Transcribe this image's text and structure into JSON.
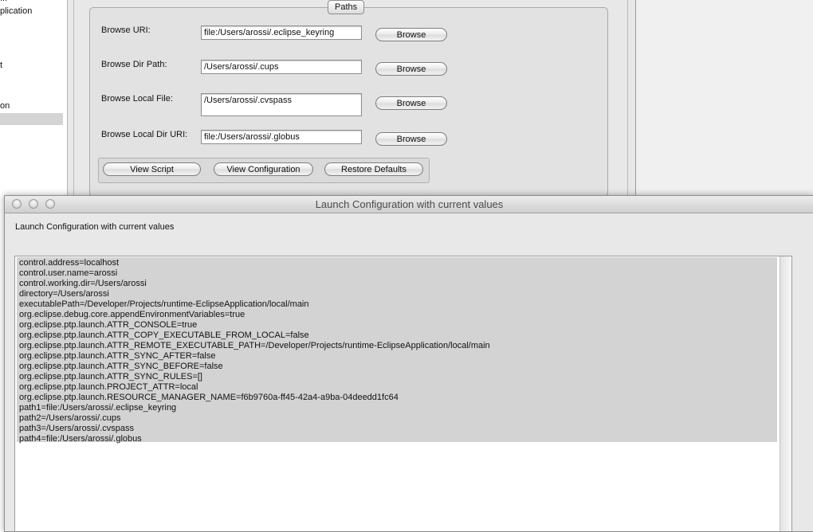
{
  "background": {
    "left_list": [
      "...",
      "plication",
      "t",
      "on"
    ],
    "group_title": "Paths",
    "fields": [
      {
        "label": "Browse URI:",
        "value": "file:/Users/arossi/.eclipse_keyring",
        "button": "Browse"
      },
      {
        "label": "Browse Dir Path:",
        "value": "/Users/arossi/.cups",
        "button": "Browse"
      },
      {
        "label": "Browse Local File:",
        "value": " /Users/arossi/.cvspass",
        "button": "Browse"
      },
      {
        "label": "Browse Local Dir URI:",
        "value": "file:/Users/arossi/.globus",
        "button": "Browse"
      }
    ],
    "actions": {
      "view_script": "View Script",
      "view_configuration": "View Configuration",
      "restore_defaults": "Restore Defaults"
    }
  },
  "window": {
    "title": "Launch Configuration with current values",
    "subtitle": "Launch Configuration with current values",
    "lines": [
      "control.address=localhost",
      "control.user.name=arossi",
      "control.working.dir=/Users/arossi",
      "directory=/Users/arossi",
      "executablePath=/Developer/Projects/runtime-EclipseApplication/local/main",
      "org.eclipse.debug.core.appendEnvironmentVariables=true",
      "org.eclipse.ptp.launch.ATTR_CONSOLE=true",
      "org.eclipse.ptp.launch.ATTR_COPY_EXECUTABLE_FROM_LOCAL=false",
      "org.eclipse.ptp.launch.ATTR_REMOTE_EXECUTABLE_PATH=/Developer/Projects/runtime-EclipseApplication/local/main",
      "org.eclipse.ptp.launch.ATTR_SYNC_AFTER=false",
      "org.eclipse.ptp.launch.ATTR_SYNC_BEFORE=false",
      "org.eclipse.ptp.launch.ATTR_SYNC_RULES=[]",
      "org.eclipse.ptp.launch.PROJECT_ATTR=local",
      "org.eclipse.ptp.launch.RESOURCE_MANAGER_NAME=f6b9760a-ff45-42a4-a9ba-04deedd1fc64",
      "path1=file:/Users/arossi/.eclipse_keyring",
      "path2=/Users/arossi/.cups",
      "path3=/Users/arossi/.cvspass",
      "path4=file:/Users/arossi/.globus"
    ]
  }
}
